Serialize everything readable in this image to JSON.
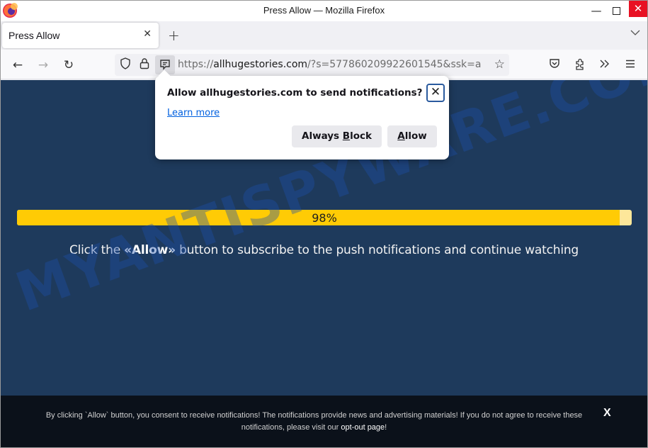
{
  "window": {
    "title": "Press Allow — Mozilla Firefox",
    "minimize_glyph": "—",
    "close_glyph": "✕"
  },
  "tabs": [
    {
      "title": "Press Allow",
      "close_glyph": "✕",
      "active": true
    }
  ],
  "tabbar": {
    "new_tab_glyph": "+",
    "list_all_tabs_glyph": "⌵"
  },
  "navbar": {
    "back_glyph": "←",
    "forward_glyph": "→",
    "reload_glyph": "↻",
    "url_scheme": "https://",
    "url_host": "allhugestories.com",
    "url_rest": "/?s=577860209922601545&ssk=a",
    "icons": [
      "shield-icon",
      "lock-icon",
      "notification-permission-icon",
      "bookmark-star-icon",
      "pocket-icon",
      "extensions-icon",
      "overflow-chevrons-icon",
      "hamburger-menu-icon"
    ]
  },
  "notification_prompt": {
    "title": "Allow allhugestories.com to send notifications?",
    "learn_more": "Learn more",
    "block_label_pre": "Always ",
    "block_label_key": "B",
    "block_label_post": "lock",
    "allow_label_key": "A",
    "allow_label_post": "llow",
    "close_glyph": "✕"
  },
  "page": {
    "progress_value": 98,
    "progress_label": "98%",
    "instruction_pre": "Click the ",
    "instruction_bold": "«Allow»",
    "instruction_post": " button to subscribe to the push notifications and continue watching",
    "watermark": "MYANTISPYWARE.COM",
    "colors": {
      "background": "#1e3a5c",
      "progress_fill": "#ffcb05",
      "progress_track": "#fde79a"
    }
  },
  "footer": {
    "text": "By clicking `Allow` button, you consent to receive notifications! The notifications provide news and advertising materials! If you do not agree to receive these notifications, please visit our ",
    "link": "opt-out page",
    "text_end": "!",
    "close_glyph": "X"
  }
}
